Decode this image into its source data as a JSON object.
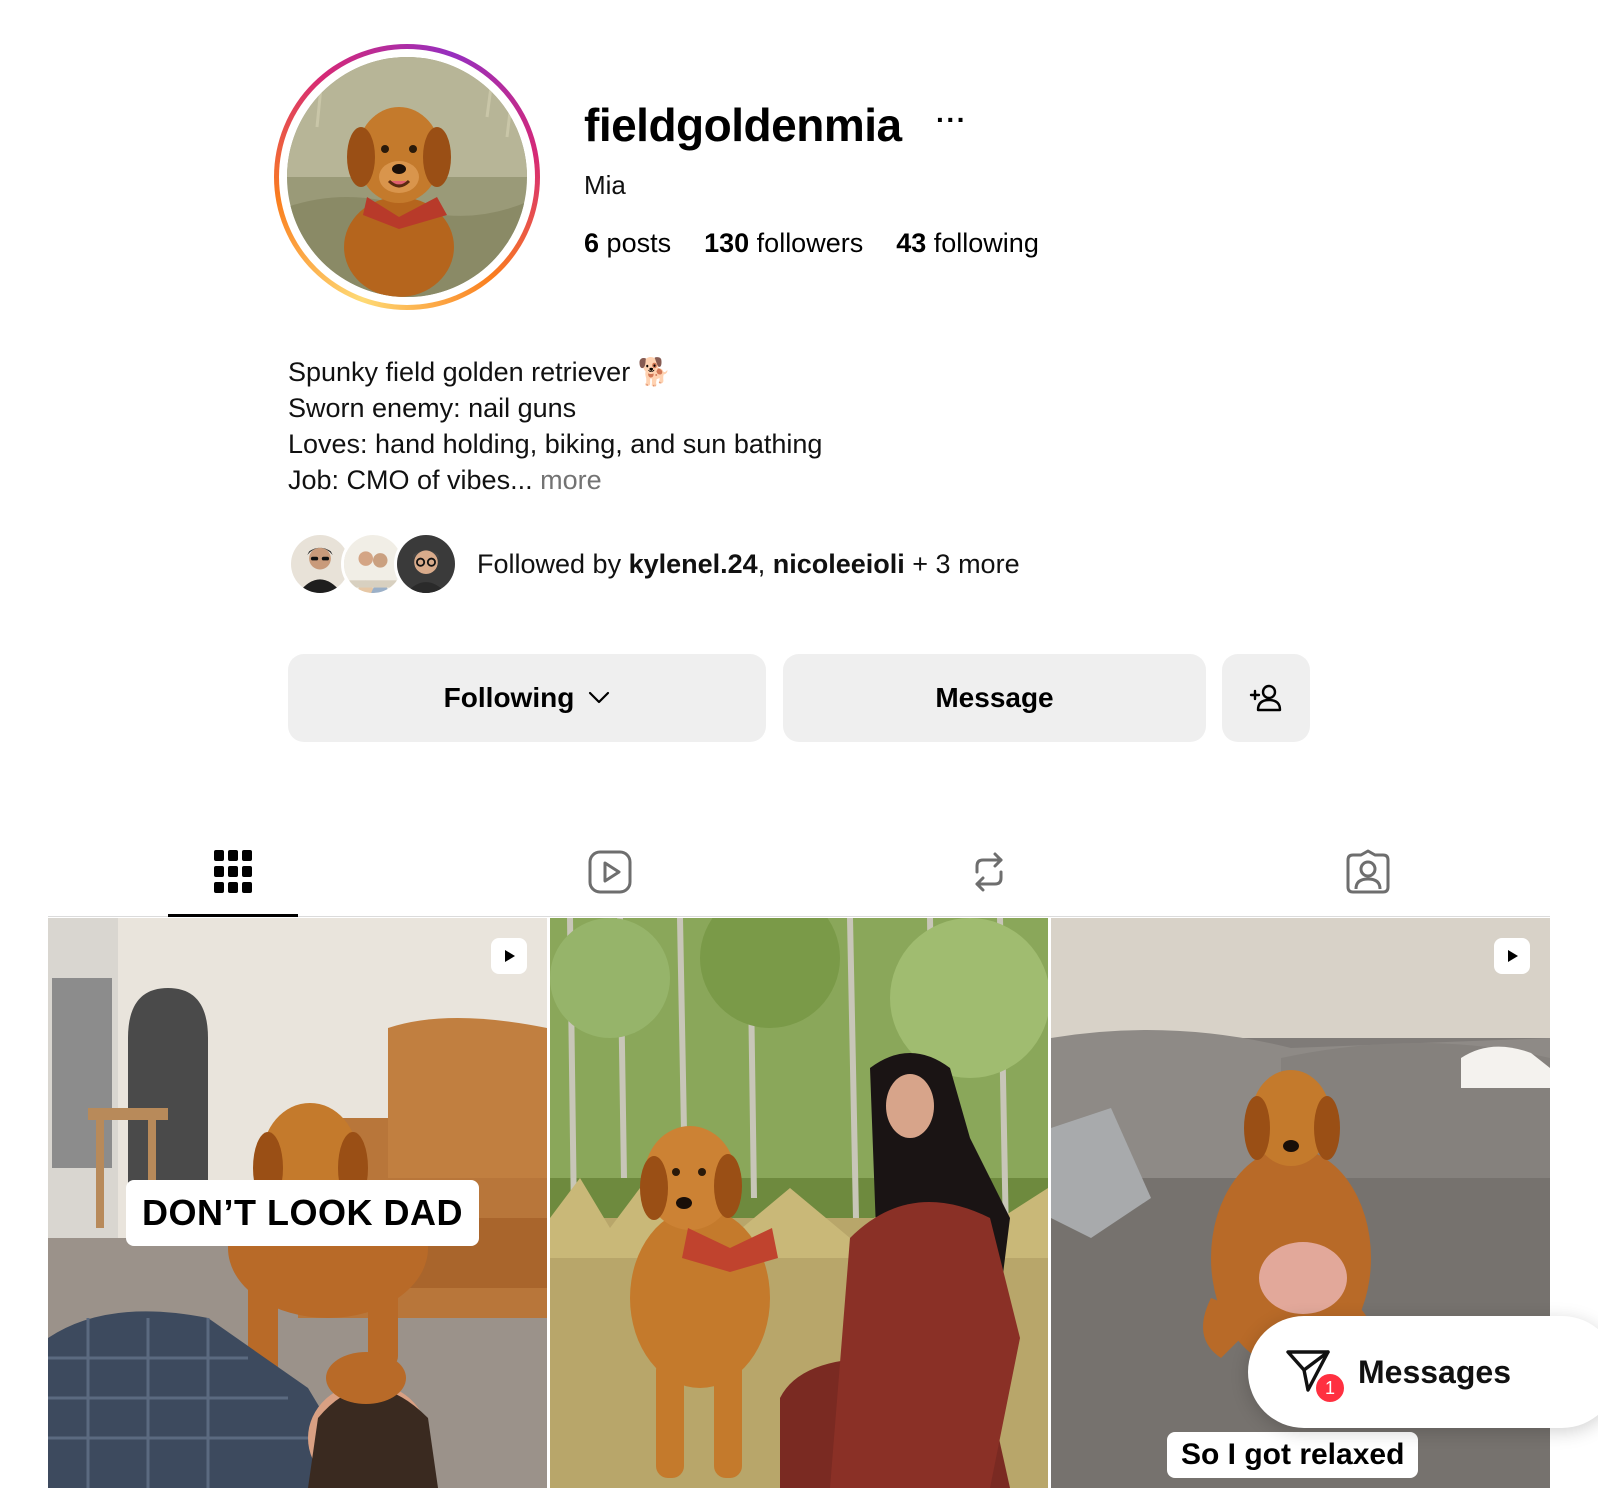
{
  "profile": {
    "username": "fieldgoldenmia",
    "more_options": "···",
    "full_name": "Mia",
    "stats": {
      "posts_count": "6",
      "posts_label": "posts",
      "followers_count": "130",
      "followers_label": "followers",
      "following_count": "43",
      "following_label": "following"
    },
    "bio": {
      "line1": "Spunky field golden retriever 🐕",
      "line2": "Sworn enemy: nail guns",
      "line3": "Loves: hand holding, biking, and sun bathing",
      "line4": "Job: CMO of vibes...",
      "more": "more"
    },
    "followed_by": {
      "prefix": "Followed by",
      "user1": "kylenel.24",
      "separator": ",",
      "user2": "nicoleeioli",
      "suffix": "+ 3 more"
    }
  },
  "actions": {
    "following_label": "Following",
    "message_label": "Message",
    "add_user_icon": "person-add-icon"
  },
  "tabs": [
    {
      "name": "posts",
      "icon": "grid-icon",
      "active": true
    },
    {
      "name": "reels",
      "icon": "reels-icon",
      "active": false
    },
    {
      "name": "reposts",
      "icon": "repost-icon",
      "active": false
    },
    {
      "name": "tagged",
      "icon": "tagged-icon",
      "active": false
    }
  ],
  "posts": [
    {
      "type": "reel",
      "caption": "DON’T LOOK DAD"
    },
    {
      "type": "photo",
      "caption": ""
    },
    {
      "type": "reel",
      "caption": "So I got relaxed"
    }
  ],
  "messages": {
    "label": "Messages",
    "unread": "1"
  },
  "colors": {
    "button_bg": "#efefef",
    "link_muted": "#737373",
    "badge_red": "#ff3040",
    "story_ring": [
      "#feda75",
      "#fa7e1e",
      "#d62976",
      "#962fbf"
    ]
  }
}
